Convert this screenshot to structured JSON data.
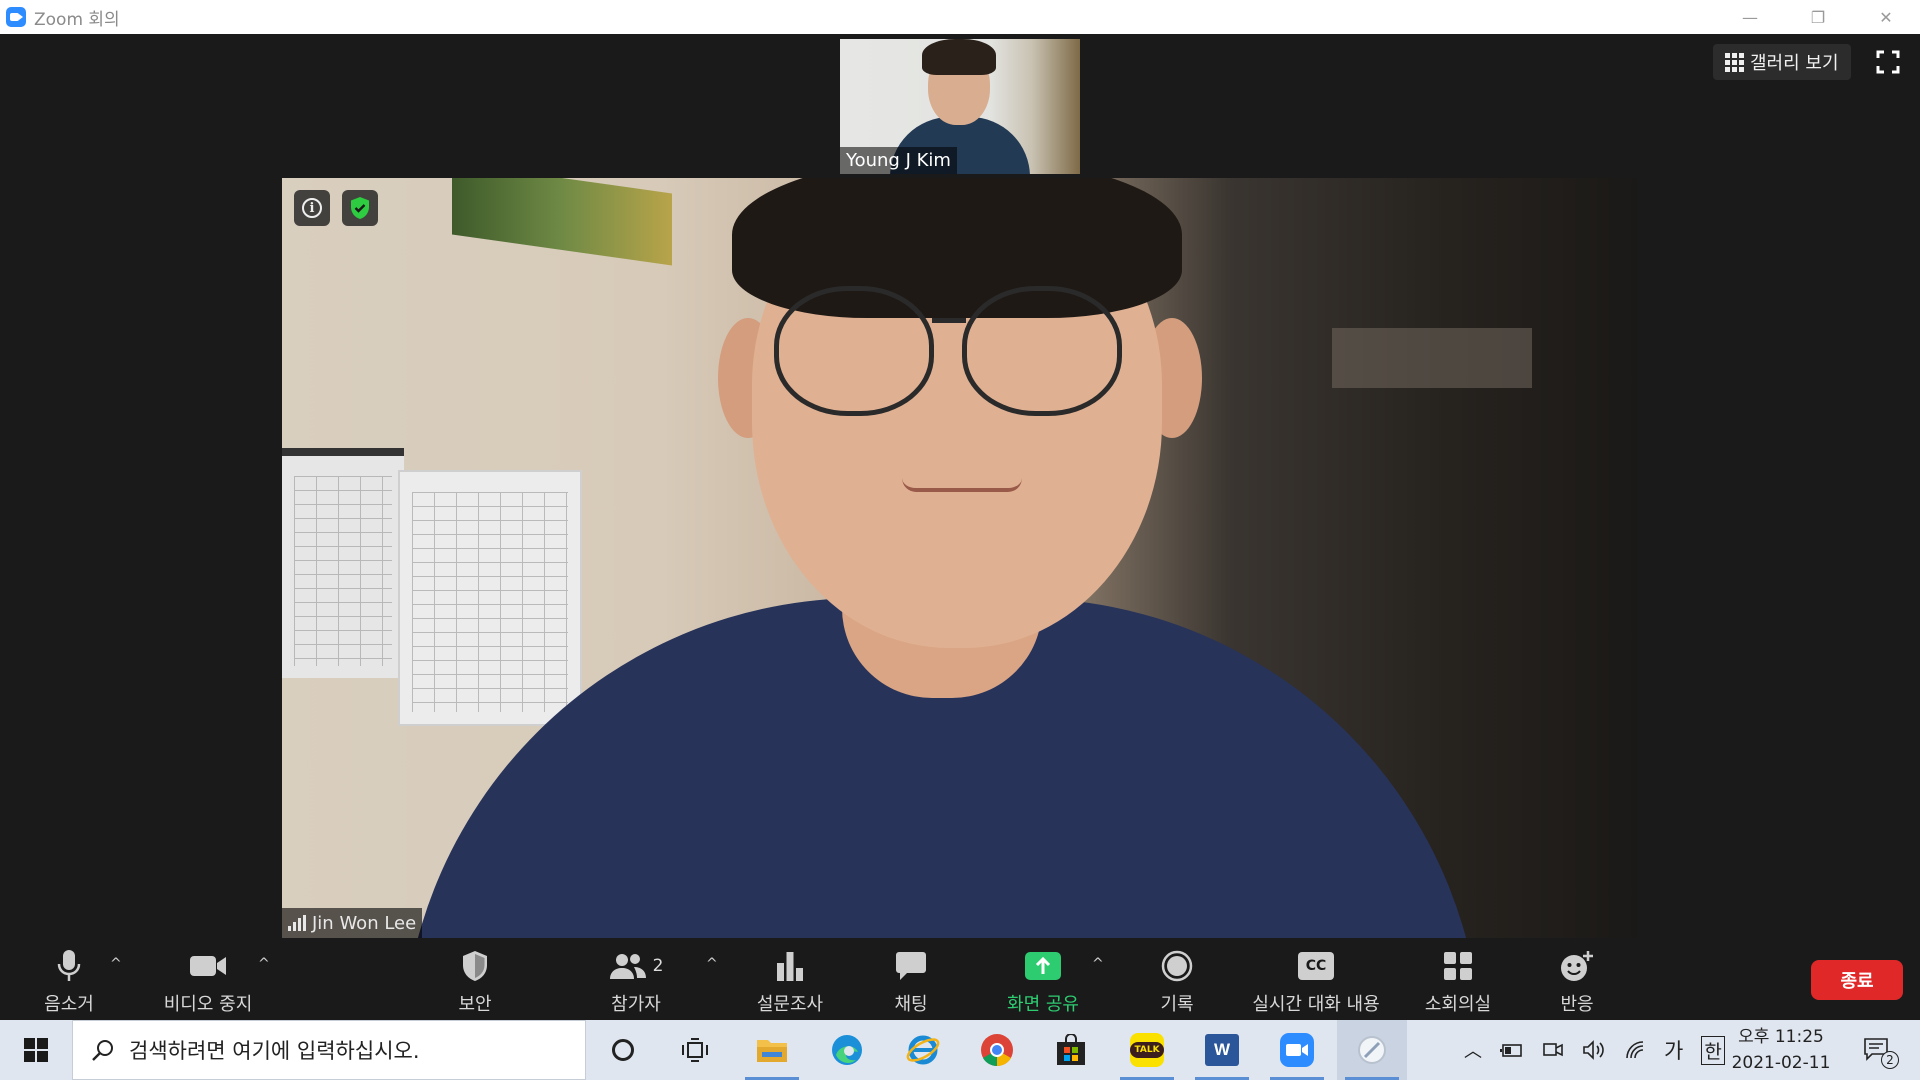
{
  "window": {
    "title": "Zoom 회의"
  },
  "thumbnail": {
    "participant_name": "Young J Kim"
  },
  "main_video": {
    "participant_name": "Jin Won Lee",
    "signal_icon": "signal-bars-icon"
  },
  "top_right": {
    "gallery_label": "갤러리 보기"
  },
  "toolbar": {
    "mute_label": "음소거",
    "video_label": "비디오 중지",
    "security_label": "보안",
    "participants_label": "참가자",
    "participants_count": "2",
    "polls_label": "설문조사",
    "chat_label": "채팅",
    "share_label": "화면 공유",
    "record_label": "기록",
    "cc_label": "실시간 대화 내용",
    "cc_badge": "CC",
    "breakout_label": "소회의실",
    "reactions_label": "반응",
    "end_label": "종료"
  },
  "taskbar": {
    "search_placeholder": "검색하려면 여기에 입력하십시오.",
    "ime_label": "가",
    "lang_label": "한",
    "clock_time": "오후 11:25",
    "clock_date": "2021-02-11",
    "notification_count": "2",
    "kakao_label": "TALK",
    "word_label": "W"
  },
  "colors": {
    "share_green": "#2ecc71",
    "end_red": "#e02828",
    "zoom_blue": "#2d8cff"
  }
}
